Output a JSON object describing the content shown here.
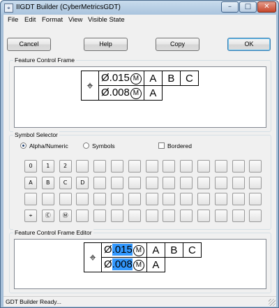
{
  "window": {
    "title": "IIGDT Builder (CyberMetricsGDT)",
    "app_icon": "⌖",
    "minimize": "–",
    "maximize": "□",
    "close": "✕"
  },
  "menu": [
    "File",
    "Edit",
    "Format",
    "View",
    "Visible State"
  ],
  "buttons": {
    "cancel": "Cancel",
    "help": "Help",
    "copy": "Copy",
    "ok": "OK"
  },
  "fcf_group": {
    "label": "Feature Control Frame",
    "symbol": "⌖",
    "row1": {
      "diameter": "Ø",
      "tolerance": ".015",
      "modifier": "M",
      "datums": [
        "A",
        "B",
        "C"
      ]
    },
    "row2": {
      "diameter": "Ø",
      "tolerance": ".008",
      "modifier": "M",
      "datums": [
        "A"
      ]
    }
  },
  "symbol_selector": {
    "label": "Symbol Selector",
    "modes": [
      {
        "label": "Alpha/Numeric",
        "selected": true
      },
      {
        "label": "Symbols",
        "selected": false
      }
    ],
    "bordered": {
      "label": "Bordered",
      "checked": false
    },
    "cells": [
      [
        "0",
        "1",
        "2",
        "",
        "",
        "",
        "",
        "",
        "",
        "",
        "",
        "",
        "",
        ""
      ],
      [
        "A",
        "B",
        "C",
        "D",
        "",
        "",
        "",
        "",
        "",
        "",
        "",
        "",
        "",
        ""
      ],
      [
        "",
        "",
        "",
        "",
        "",
        "",
        "",
        "",
        "",
        "",
        "",
        "",
        "",
        ""
      ],
      [
        "⌖",
        "Ⓒ",
        "Ⓜ",
        "",
        "",
        "",
        "",
        "",
        "",
        "",
        "",
        "",
        "",
        ""
      ]
    ]
  },
  "editor_group": {
    "label": "Feature Control Frame Editor",
    "symbol": "⌖",
    "row1": {
      "diameter": "Ø",
      "tolerance": ".015",
      "modifier": "M",
      "datums": [
        "A",
        "B",
        "C"
      ]
    },
    "row2": {
      "diameter": "Ø",
      "tolerance": ".008",
      "modifier": "M",
      "datums": [
        "A"
      ]
    },
    "highlight_color": "#3399ff"
  },
  "status": "GDT Builder Ready..."
}
